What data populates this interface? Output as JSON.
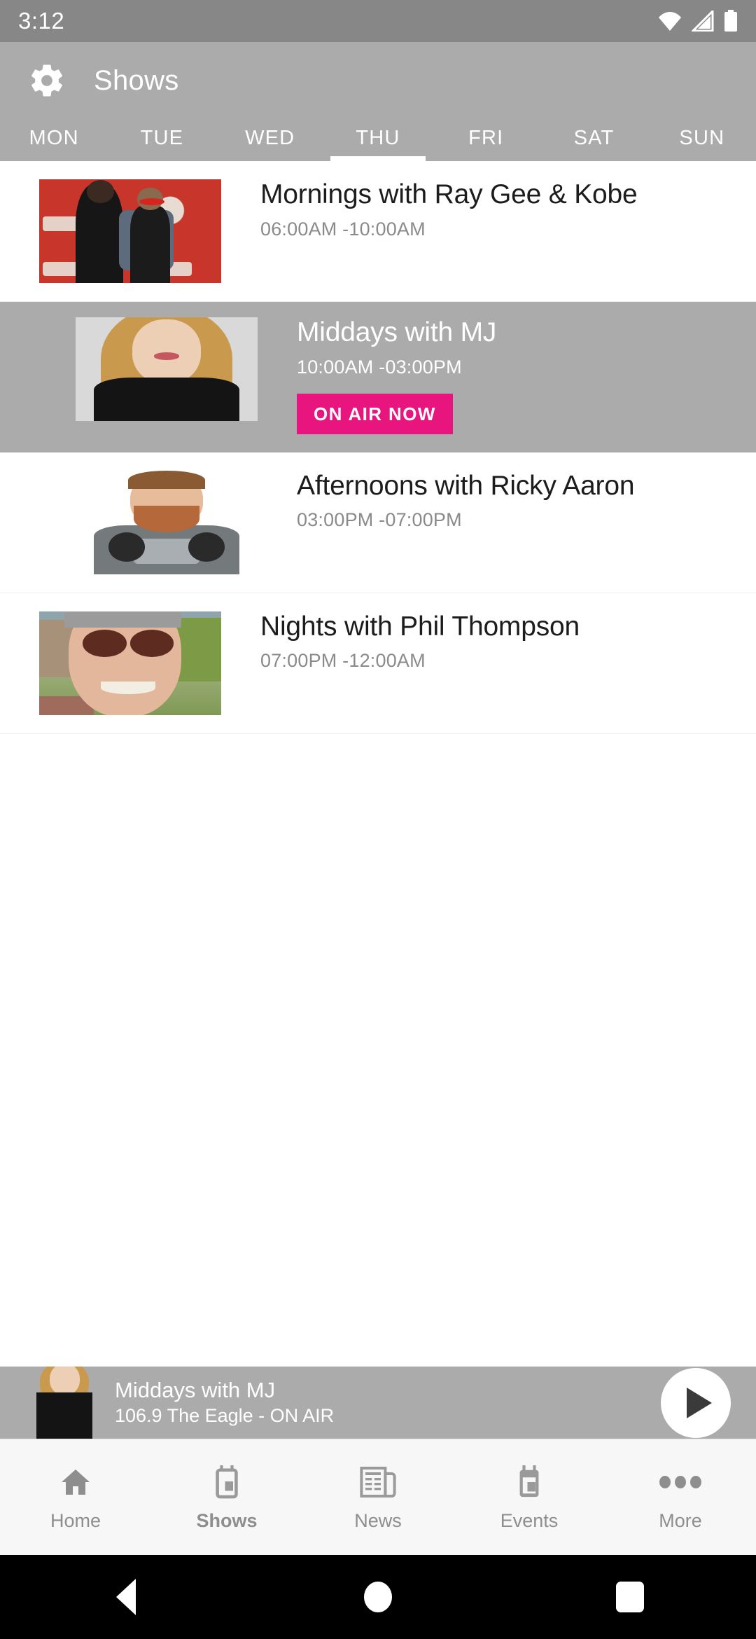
{
  "statusbar": {
    "time": "3:12",
    "icons": [
      "wifi-icon",
      "cellular-signal-icon",
      "battery-icon"
    ]
  },
  "appbar": {
    "title": "Shows",
    "settings_icon": "gear-icon",
    "bg_color": "#ababab"
  },
  "daytabs": {
    "active_index": 3,
    "items": [
      {
        "label": "MON"
      },
      {
        "label": "TUE"
      },
      {
        "label": "WED"
      },
      {
        "label": "THU"
      },
      {
        "label": "FRI"
      },
      {
        "label": "SAT"
      },
      {
        "label": "SUN"
      }
    ]
  },
  "shows": [
    {
      "title": "Mornings with Ray Gee & Kobe",
      "time": "06:00AM -10:00AM",
      "on_air": false,
      "badge": ""
    },
    {
      "title": "Middays with MJ",
      "time": "10:00AM -03:00PM",
      "on_air": true,
      "badge": "ON AIR NOW"
    },
    {
      "title": "Afternoons with Ricky Aaron",
      "time": "03:00PM -07:00PM",
      "on_air": false,
      "badge": ""
    },
    {
      "title": "Nights with Phil Thompson",
      "time": "07:00PM -12:00AM",
      "on_air": false,
      "badge": ""
    }
  ],
  "miniplayer": {
    "title": "Middays with MJ",
    "subtitle": "106.9 The Eagle - ON AIR",
    "play_icon": "play-icon",
    "bg_color": "#ababab"
  },
  "bottomnav": {
    "active_index": 1,
    "items": [
      {
        "label": "Home",
        "icon": "home-icon"
      },
      {
        "label": "Shows",
        "icon": "radio-icon"
      },
      {
        "label": "News",
        "icon": "newspaper-icon"
      },
      {
        "label": "Events",
        "icon": "radio-icon"
      },
      {
        "label": "More",
        "icon": "ellipsis-icon"
      }
    ]
  },
  "sysnav": {
    "back": "back-icon",
    "home": "home-circle-icon",
    "recents": "recents-square-icon"
  },
  "colors": {
    "accent_badge": "#e8157f",
    "appbar": "#ababab",
    "statusbar": "#878787",
    "nav_bg": "#f7f7f7"
  }
}
